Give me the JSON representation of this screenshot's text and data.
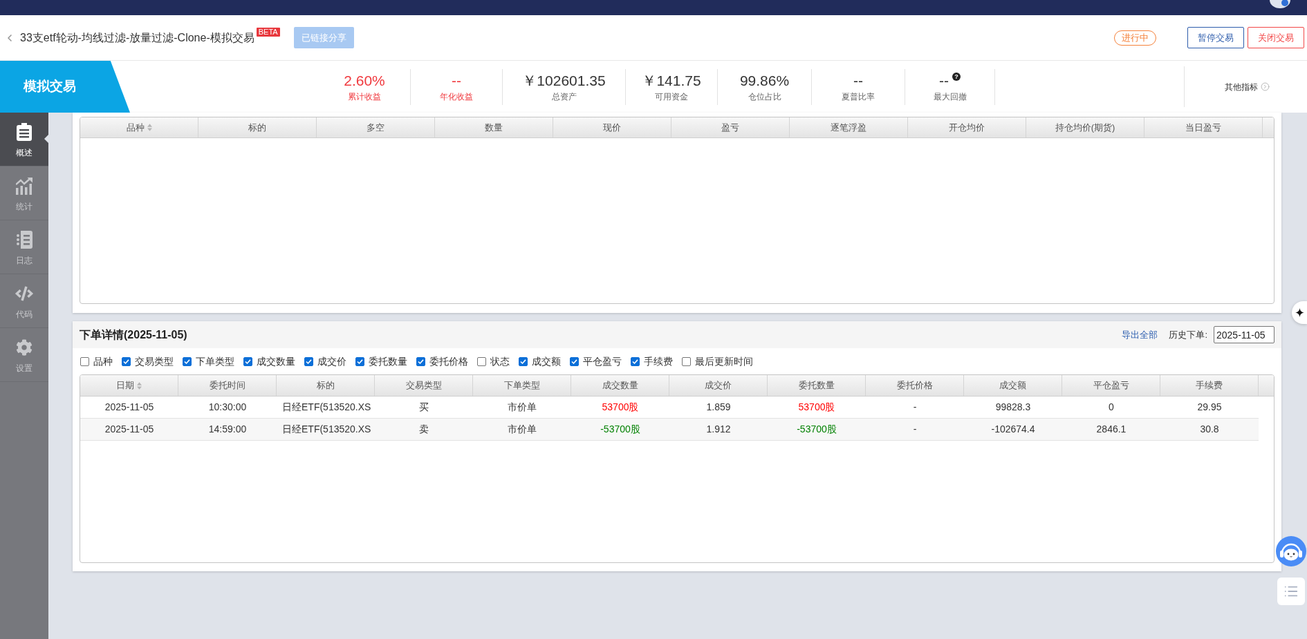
{
  "header": {
    "title": "33支etf轮动-均线过滤-放量过滤-Clone-模拟交易",
    "badge": "BETA",
    "share_button": "已链接分享",
    "status": "进行中",
    "buttons": [
      {
        "label": "暂停交易",
        "kind": "pause"
      },
      {
        "label": "关闭交易",
        "kind": "close"
      }
    ]
  },
  "summary": {
    "mode": "模拟交易",
    "stats": [
      {
        "value": "2.60%",
        "label": "累计收益",
        "highlighted": true
      },
      {
        "value": "--",
        "label": "年化收益",
        "highlighted": true
      },
      {
        "value": "￥102601.35",
        "label": "总资产",
        "highlighted": false
      },
      {
        "value": "￥141.75",
        "label": "可用资金",
        "highlighted": false
      },
      {
        "value": "99.86%",
        "label": "仓位占比",
        "highlighted": false
      },
      {
        "value": "--",
        "label": "夏普比率",
        "highlighted": false
      },
      {
        "value": "--",
        "label": "最大回撤",
        "highlighted": false,
        "help_icon": "?"
      }
    ],
    "more": "其他指标"
  },
  "sidebar": {
    "items": [
      {
        "label": "概述",
        "kind": "overview",
        "selected": true
      },
      {
        "label": "统计",
        "kind": "stats",
        "selected": false
      },
      {
        "label": "日志",
        "kind": "log",
        "selected": false
      },
      {
        "label": "代码",
        "kind": "code",
        "selected": false
      },
      {
        "label": "设置",
        "kind": "settings",
        "selected": false
      }
    ]
  },
  "positions": {
    "columns": [
      {
        "label": "品种",
        "sortable": true
      },
      {
        "label": "标的",
        "sortable": false
      },
      {
        "label": "多空",
        "sortable": false
      },
      {
        "label": "数量",
        "sortable": false
      },
      {
        "label": "现价",
        "sortable": false
      },
      {
        "label": "盈亏",
        "sortable": false
      },
      {
        "label": "逐笔浮盈",
        "sortable": false
      },
      {
        "label": "开仓均价",
        "sortable": false
      },
      {
        "label": "持仓均价(期货)",
        "sortable": false
      },
      {
        "label": "当日盈亏",
        "sortable": false
      }
    ]
  },
  "orders": {
    "title": "下单详情(2025-11-05)",
    "export": "导出全部",
    "history_label": "历史下单:",
    "history_date": "2025-11-05",
    "filters": [
      {
        "label": "品种",
        "checked": false
      },
      {
        "label": "交易类型",
        "checked": true
      },
      {
        "label": "下单类型",
        "checked": true
      },
      {
        "label": "成交数量",
        "checked": true
      },
      {
        "label": "成交价",
        "checked": true
      },
      {
        "label": "委托数量",
        "checked": true
      },
      {
        "label": "委托价格",
        "checked": true
      },
      {
        "label": "状态",
        "checked": false
      },
      {
        "label": "成交额",
        "checked": true
      },
      {
        "label": "平仓盈亏",
        "checked": true
      },
      {
        "label": "手续费",
        "checked": true
      },
      {
        "label": "最后更新时间",
        "checked": false
      }
    ],
    "columns": [
      {
        "label": "日期",
        "sortable": true,
        "colored": false
      },
      {
        "label": "委托时间",
        "sortable": false,
        "colored": false
      },
      {
        "label": "标的",
        "sortable": false,
        "colored": false
      },
      {
        "label": "交易类型",
        "sortable": false,
        "colored": false
      },
      {
        "label": "下单类型",
        "sortable": false,
        "colored": false
      },
      {
        "label": "成交数量",
        "sortable": false,
        "colored": true
      },
      {
        "label": "成交价",
        "sortable": false,
        "colored": false
      },
      {
        "label": "委托数量",
        "sortable": false,
        "colored": true
      },
      {
        "label": "委托价格",
        "sortable": false,
        "colored": false
      },
      {
        "label": "成交额",
        "sortable": false,
        "colored": false
      },
      {
        "label": "平仓盈亏",
        "sortable": false,
        "colored": false
      },
      {
        "label": "手续费",
        "sortable": false,
        "colored": false
      }
    ],
    "rows": [
      {
        "kind": "buy",
        "cells": [
          "2025-11-05",
          "10:30:00",
          "日经ETF(513520.XS",
          "买",
          "市价单",
          "53700股",
          "1.859",
          "53700股",
          "-",
          "99828.3",
          "0",
          "29.95"
        ]
      },
      {
        "kind": "sell",
        "cells": [
          "2025-11-05",
          "14:59:00",
          "日经ETF(513520.XS",
          "卖",
          "市价单",
          "-53700股",
          "1.912",
          "-53700股",
          "-",
          "-102674.4",
          "2846.1",
          "30.8"
        ]
      }
    ]
  }
}
